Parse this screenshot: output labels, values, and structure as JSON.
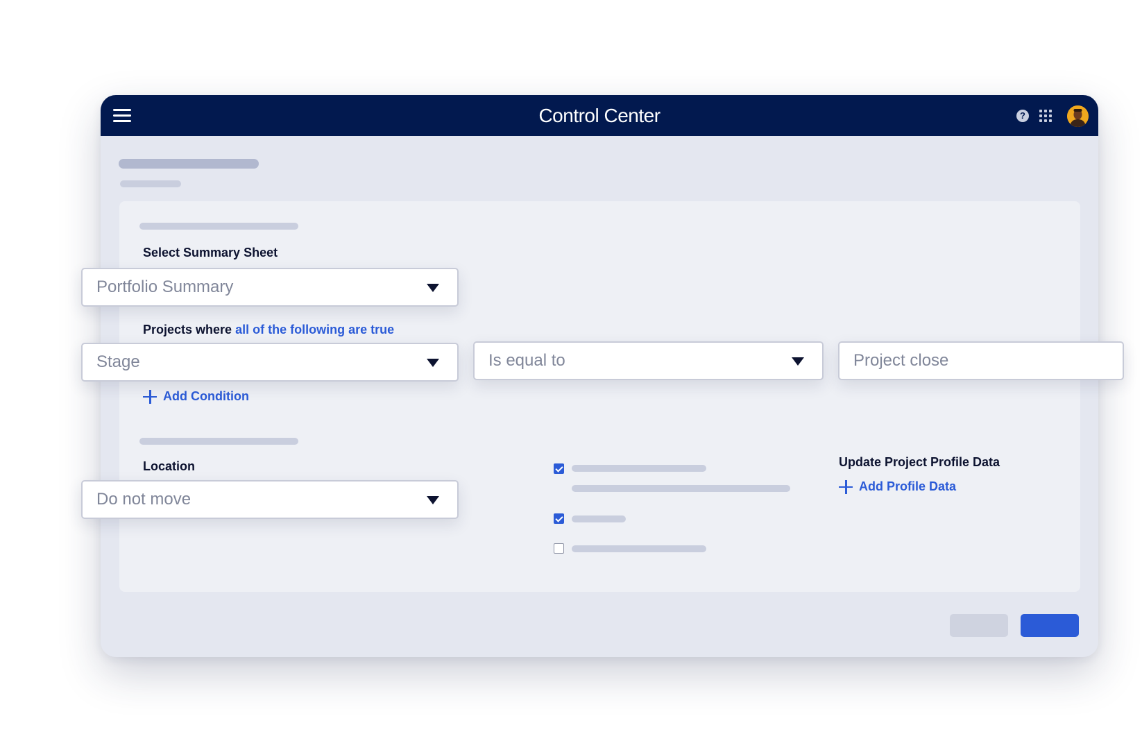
{
  "app": {
    "title": "Control Center"
  },
  "form": {
    "summary_sheet": {
      "label": "Select Summary Sheet",
      "value": "Portfolio Summary"
    },
    "conditions": {
      "label_prefix": "Projects where",
      "label_link": "all of the following are true",
      "field": "Stage",
      "operator": "Is equal to",
      "value": "Project close",
      "add_label": "Add Condition"
    },
    "location": {
      "label": "Location",
      "value": "Do not move"
    },
    "options": [
      {
        "checked": true
      },
      {
        "checked": true
      },
      {
        "checked": false
      }
    ],
    "profile_data": {
      "label": "Update Project Profile Data",
      "add_label": "Add Profile Data"
    }
  },
  "colors": {
    "titlebar": "#02194f",
    "accent": "#2b5bd7",
    "window_bg": "#e4e7f0",
    "panel_bg": "#eef0f5",
    "skeleton": "#b1b8cf"
  },
  "icons": [
    "menu-icon",
    "help-icon",
    "apps-grid-icon",
    "user-avatar",
    "chevron-down-icon",
    "plus-icon",
    "checkbox-icon"
  ]
}
